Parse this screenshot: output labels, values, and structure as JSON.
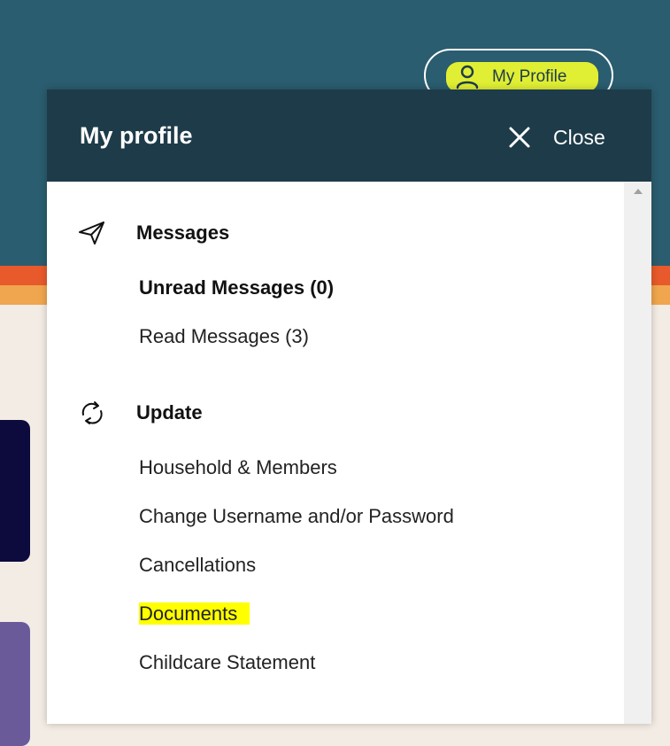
{
  "header": {
    "profile_button_label": "My Profile"
  },
  "panel": {
    "title": "My profile",
    "close_label": "Close",
    "sections": [
      {
        "title": "Messages",
        "icon": "paper-plane-icon",
        "items": [
          "Unread Messages (0)",
          "Read Messages (3)"
        ]
      },
      {
        "title": "Update",
        "icon": "refresh-icon",
        "items": [
          "Household & Members",
          "Change Username and/or Password",
          "Cancellations",
          "Documents",
          "Childcare Statement"
        ]
      }
    ],
    "highlighted_item": "Documents"
  },
  "colors": {
    "header_bg": "#2a5d6f",
    "panel_header_bg": "#1e3b49",
    "accent": "#e0ef34",
    "highlight": "#ffff00"
  }
}
